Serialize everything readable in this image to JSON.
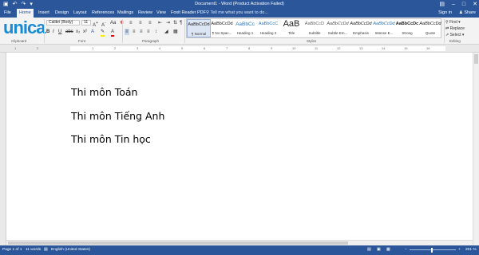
{
  "titlebar": {
    "title": "Document1 - Word (Product Activation Failed)",
    "qat": [
      "save-icon",
      "undo-icon",
      "redo-icon",
      "customize-icon"
    ],
    "controls": [
      "ribbon-display-icon",
      "minimize-icon",
      "maximize-icon",
      "close-icon"
    ]
  },
  "tabs": [
    {
      "label": "File"
    },
    {
      "label": "Home"
    },
    {
      "label": "Insert"
    },
    {
      "label": "Design"
    },
    {
      "label": "Layout"
    },
    {
      "label": "References"
    },
    {
      "label": "Mailings"
    },
    {
      "label": "Review"
    },
    {
      "label": "View"
    },
    {
      "label": "Foxit Reader PDF"
    }
  ],
  "tellme": "Tell me what you want to do...",
  "signin": "Sign in",
  "share": "Share",
  "logo": "unica",
  "font": {
    "name": "Calibri (Body)",
    "size": "11"
  },
  "groups": {
    "clipboard": "Clipboard",
    "font": "Font",
    "paragraph": "Paragraph",
    "styles": "Styles",
    "editing": "Editing"
  },
  "styles": [
    {
      "sample": "AaBbCcDd",
      "name": "¶ Normal"
    },
    {
      "sample": "AaBbCcDd",
      "name": "¶ No Spac..."
    },
    {
      "sample": "AaBbCc",
      "name": "Heading 1"
    },
    {
      "sample": "AaBbCcC",
      "name": "Heading 2"
    },
    {
      "sample": "AaB",
      "name": "Title"
    },
    {
      "sample": "AaBbCcD",
      "name": "Subtitle"
    },
    {
      "sample": "AaBbCcDd",
      "name": "Subtle Em..."
    },
    {
      "sample": "AaBbCcDd",
      "name": "Emphasis"
    },
    {
      "sample": "AaBbCcDd",
      "name": "Intense E..."
    },
    {
      "sample": "AaBbCcDc",
      "name": "Strong"
    },
    {
      "sample": "AaBbCcDd",
      "name": "Quote"
    }
  ],
  "editing": {
    "find": "Find",
    "replace": "Replace",
    "select": "Select"
  },
  "ruler": [
    "1",
    "2",
    "1",
    "2",
    "3",
    "4",
    "5",
    "6",
    "7",
    "8",
    "9",
    "10",
    "11",
    "12",
    "13",
    "14",
    "15",
    "16"
  ],
  "document": {
    "paragraphs": [
      "Thi môn Toán",
      "Thi môn Tiếng Anh",
      "Thi môn Tin học"
    ]
  },
  "status": {
    "page": "Page 1 of 1",
    "words": "11 words",
    "language": "English (United States)",
    "zoom": "201 %",
    "zoom_minus": "−",
    "zoom_plus": "+"
  },
  "colors": {
    "accent": "#2b579a",
    "logo": "#1a8ad4"
  }
}
